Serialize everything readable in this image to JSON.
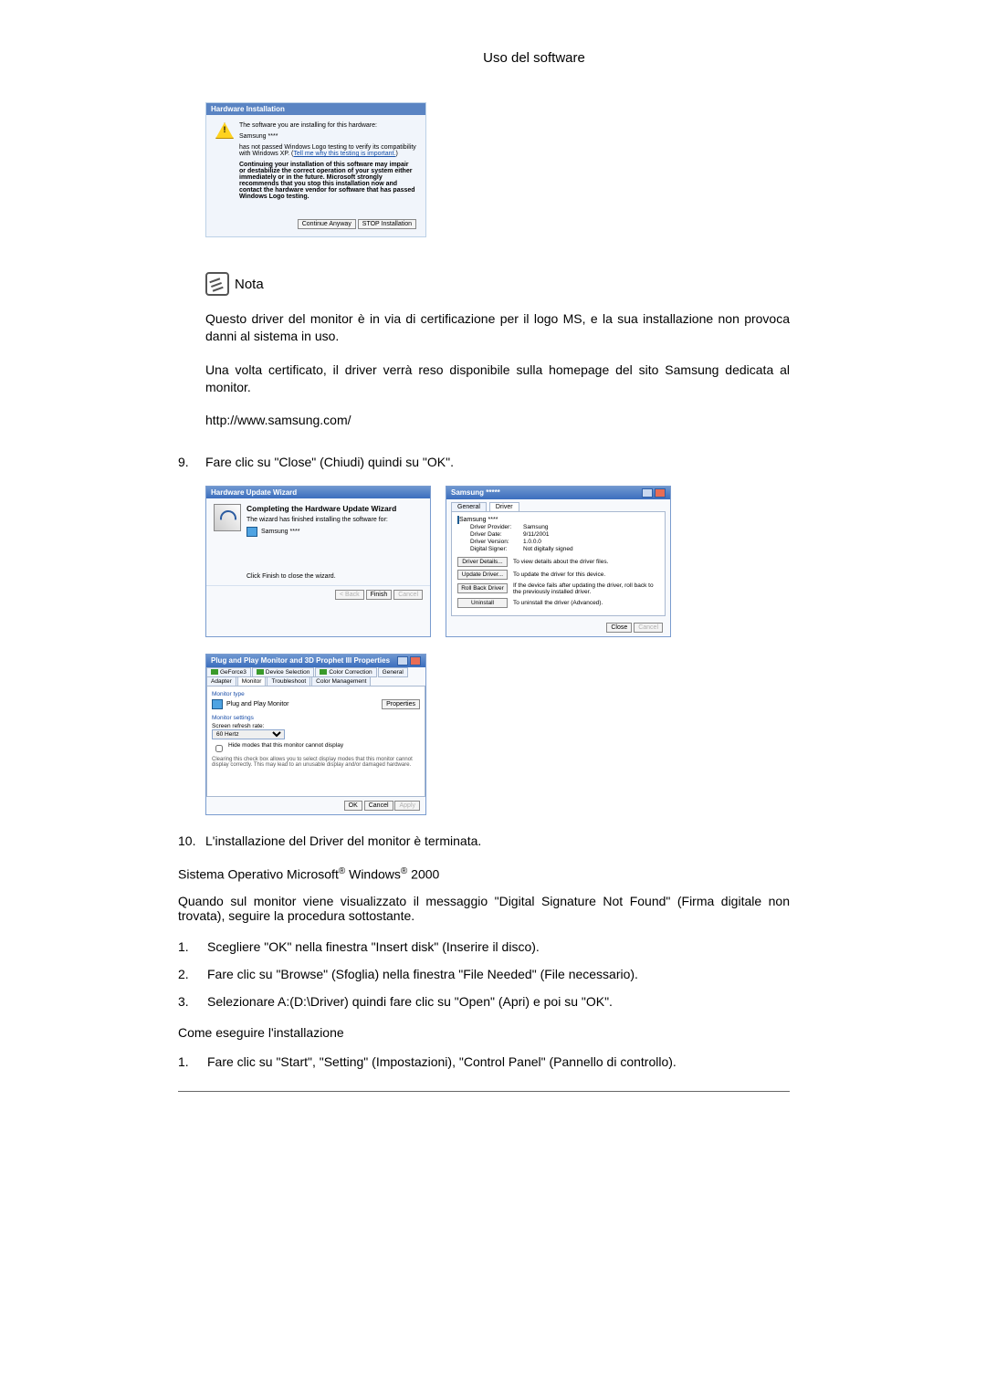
{
  "header": "Uso del software",
  "hw_install": {
    "title": "Hardware Installation",
    "line1": "The software you are installing for this hardware:",
    "device": "Samsung ****",
    "line2a": "has not passed Windows Logo testing to verify its compatibility with Windows XP. (",
    "link": "Tell me why this testing is important.",
    "line2b": ")",
    "warn": "Continuing your installation of this software may impair or destabilize the correct operation of your system either immediately or in the future. Microsoft strongly recommends that you stop this installation now and contact the hardware vendor for software that has passed Windows Logo testing.",
    "btn_continue": "Continue Anyway",
    "btn_stop": "STOP Installation"
  },
  "note_label": "Nota",
  "note_p1": "Questo driver del monitor è in via di certificazione per il logo MS, e la sua installazione non provoca danni al sistema in uso.",
  "note_p2": "Una volta certificato, il driver verrà reso disponibile sulla homepage del sito Samsung dedicata al monitor.",
  "url": "http://www.samsung.com/",
  "step9_num": "9.",
  "step9_txt": "Fare clic su \"Close\" (Chiudi) quindi su \"OK\".",
  "wizard": {
    "title": "Hardware Update Wizard",
    "h": "Completing the Hardware Update Wizard",
    "sub": "The wizard has finished installing the software for:",
    "device": "Samsung ****",
    "hint": "Click Finish to close the wizard.",
    "back": "< Back",
    "finish": "Finish",
    "cancel": "Cancel"
  },
  "driver": {
    "title": "Samsung *****",
    "tab_general": "General",
    "tab_driver": "Driver",
    "device": "Samsung ****",
    "rows": {
      "provider_k": "Driver Provider:",
      "provider_v": "Samsung",
      "date_k": "Driver Date:",
      "date_v": "9/11/2001",
      "ver_k": "Driver Version:",
      "ver_v": "1.0.0.0",
      "signer_k": "Digital Signer:",
      "signer_v": "Not digitally signed"
    },
    "btns": {
      "details": "Driver Details...",
      "details_d": "To view details about the driver files.",
      "update": "Update Driver...",
      "update_d": "To update the driver for this device.",
      "roll": "Roll Back Driver",
      "roll_d": "If the device fails after updating the driver, roll back to the previously installed driver.",
      "uninst": "Uninstall",
      "uninst_d": "To uninstall the driver (Advanced)."
    },
    "close": "Close",
    "cancel": "Cancel"
  },
  "prophet": {
    "title": "Plug and Play Monitor and 3D Prophet III Properties",
    "tabs": {
      "geforce": "GeForce3",
      "devsel": "Device Selection",
      "color": "Color Correction",
      "general": "General",
      "adapter": "Adapter",
      "monitor": "Monitor",
      "trouble": "Troubleshoot",
      "cm": "Color Management"
    },
    "mt_label": "Monitor type",
    "mt_name": "Plug and Play Monitor",
    "props_btn": "Properties",
    "ms_label": "Monitor settings",
    "rate_label": "Screen refresh rate:",
    "rate_value": "60 Hertz",
    "hide_cb": "Hide modes that this monitor cannot display",
    "hide_note": "Clearing this check box allows you to select display modes that this monitor cannot display correctly. This may lead to an unusable display and/or damaged hardware.",
    "ok": "OK",
    "cancel": "Cancel",
    "apply": "Apply"
  },
  "step10_num": "10.",
  "step10_txt": "L'installazione del Driver del monitor è terminata.",
  "os_line_a": "Sistema Operativo Microsoft",
  "os_line_b": " Windows",
  "os_line_c": " 2000",
  "sig_p": "Quando sul monitor viene visualizzato il messaggio \"Digital Signature Not Found\" (Firma digitale non trovata), seguire la procedura sottostante.",
  "s1_num": "1.",
  "s1_txt": "Scegliere \"OK\" nella finestra \"Insert disk\" (Inserire il disco).",
  "s2_num": "2.",
  "s2_txt": "Fare clic su \"Browse\" (Sfoglia) nella finestra \"File Needed\" (File necessario).",
  "s3_num": "3.",
  "s3_txt": "Selezionare A:(D:\\Driver) quindi fare clic su \"Open\" (Apri) e poi su \"OK\".",
  "howto": "Come eseguire l'installazione",
  "h1_num": "1.",
  "h1_txt": "Fare clic su \"Start\", \"Setting\" (Impostazioni), \"Control Panel\" (Pannello di controllo)."
}
